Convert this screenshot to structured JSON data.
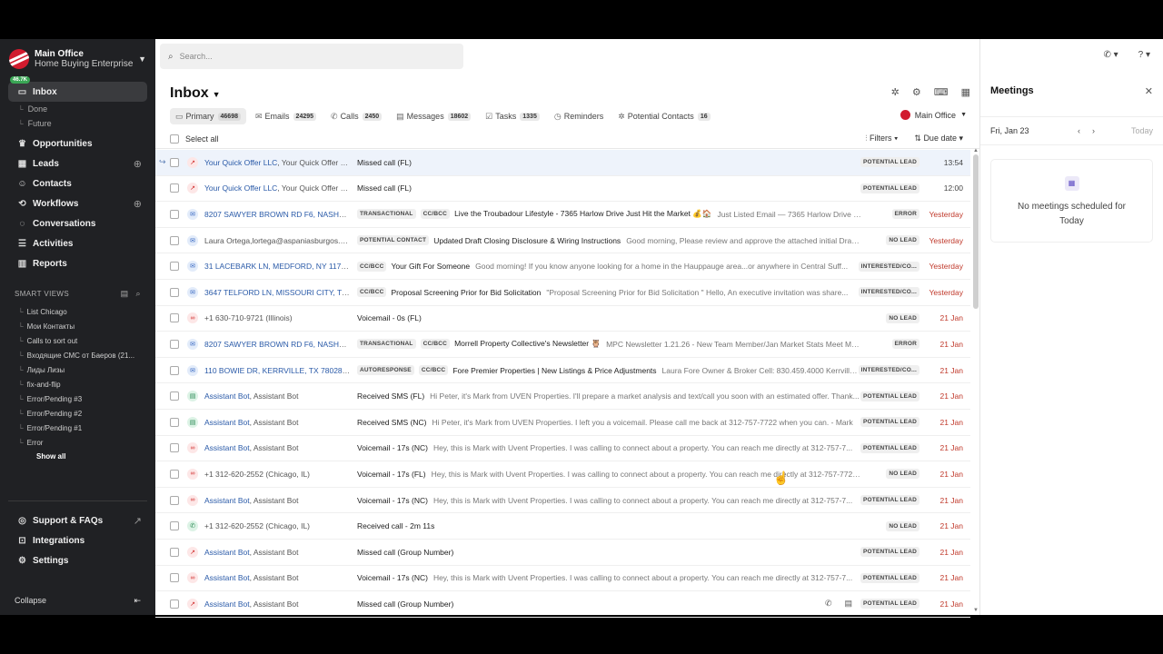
{
  "org": {
    "name": "Main Office",
    "subtitle": "Home Buying Enterprise"
  },
  "nav": {
    "inbox_badge": "46.7K",
    "inbox": "Inbox",
    "done": "Done",
    "future": "Future",
    "opportunities": "Opportunities",
    "leads": "Leads",
    "contacts": "Contacts",
    "workflows": "Workflows",
    "conversations": "Conversations",
    "activities": "Activities",
    "reports": "Reports",
    "support": "Support & FAQs",
    "integrations": "Integrations",
    "settings": "Settings",
    "collapse": "Collapse"
  },
  "smart_views": {
    "header": "SMART VIEWS",
    "items": [
      "List Chicago",
      "Мои Контакты",
      "Calls to sort out",
      "Входящие СМС от Баеров (21...",
      "Лиды Лизы",
      "fix-and-flip",
      "Error/Pending #3",
      "Error/Pending #2",
      "Error/Pending #1",
      "Error"
    ],
    "show_all": "Show all"
  },
  "search": {
    "placeholder": "Search..."
  },
  "inbox": {
    "title": "Inbox",
    "tabs": [
      {
        "label": "Primary",
        "count": "46698"
      },
      {
        "label": "Emails",
        "count": "24295"
      },
      {
        "label": "Calls",
        "count": "2450"
      },
      {
        "label": "Messages",
        "count": "18602"
      },
      {
        "label": "Tasks",
        "count": "1335"
      },
      {
        "label": "Reminders",
        "count": ""
      },
      {
        "label": "Potential Contacts",
        "count": "16"
      }
    ],
    "office": "Main Office",
    "select_all": "Select all",
    "filters": "Filters",
    "sort": "Due date"
  },
  "rows": [
    {
      "type": "missed",
      "name": "Your Quick Offer LLC",
      "extra": ", Your Quick Offer LLC",
      "tags": [],
      "subject": "Missed call (FL)",
      "preview": "",
      "status": "POTENTIAL LEAD",
      "date": "13:54",
      "now": true,
      "hl": true
    },
    {
      "type": "missed",
      "name": "Your Quick Offer LLC",
      "extra": ", Your Quick Offer LLC",
      "tags": [],
      "subject": "Missed call (FL)",
      "preview": "",
      "status": "POTENTIAL LEAD",
      "date": "12:00",
      "now": true
    },
    {
      "type": "email",
      "name": "8207 SAWYER BROWN RD F6, NASHVILL...",
      "extra": "",
      "tags": [
        "TRANSACTIONAL",
        "CC/BCC"
      ],
      "subject": "Live the Troubadour Lifestyle - 7365 Harlow Drive Just Hit the Market 💰🏠",
      "preview": "Just Listed Email — 7365 Harlow Drive Live the ...",
      "status": "ERROR",
      "date": "Yesterday"
    },
    {
      "type": "email",
      "name": "",
      "extra": "Laura Ortega,lortega@aspaniasburgos.com",
      "tags": [
        "POTENTIAL CONTACT"
      ],
      "subject": "Updated Draft Closing Disclosure & Wiring Instructions",
      "preview": "Good morning, Please review and approve the attached initial Draft C...",
      "status": "NO LEAD",
      "date": "Yesterday"
    },
    {
      "type": "email",
      "name": "31 LACEBARK LN, MEDFORD, NY 11763 ...",
      "extra": "",
      "tags": [
        "CC/BCC"
      ],
      "subject": "Your Gift For Someone",
      "preview": "Good morning! If you know anyone looking for a home in the Hauppauge area...or anywhere in Central Suff...",
      "status": "INTERESTED/CO...",
      "date": "Yesterday"
    },
    {
      "type": "email",
      "name": "3647 TELFORD LN, MISSOURI CITY, TX 7...",
      "extra": "",
      "tags": [
        "CC/BCC"
      ],
      "subject": "Proposal Screening Prior for Bid Solicitation",
      "preview": "\"Proposal Screening Prior for Bid Solicitation \" Hello, An executive invitation was share...",
      "status": "INTERESTED/CO...",
      "date": "Yesterday"
    },
    {
      "type": "vm",
      "name": "",
      "extra": "+1 630-710-9721 (Illinois)",
      "tags": [],
      "subject": "Voicemail - 0s (FL)",
      "preview": "",
      "status": "NO LEAD",
      "date": "21 Jan"
    },
    {
      "type": "email",
      "name": "8207 SAWYER BROWN RD F6, NASHVILL...",
      "extra": "",
      "tags": [
        "TRANSACTIONAL",
        "CC/BCC"
      ],
      "subject": "Morrell Property Collective's Newsletter 🦉",
      "preview": "MPC Newsletter 1.21.26 - New Team Member/Jan Market Stats Meet MPC's Ne...",
      "status": "ERROR",
      "date": "21 Jan"
    },
    {
      "type": "email",
      "name": "110 BOWIE DR, KERRVILLE, TX 78028 & ...",
      "extra": "",
      "tags": [
        "AUTORESPONSE",
        "CC/BCC"
      ],
      "subject": "Fore Premier Properties | New Listings & Price Adjustments",
      "preview": "Laura Fore Owner & Broker Cell: 830.459.4000 Kerrville:...",
      "status": "INTERESTED/CO...",
      "date": "21 Jan"
    },
    {
      "type": "sms",
      "name": "Assistant Bot",
      "extra": ", Assistant Bot",
      "tags": [],
      "subject": "Received SMS (FL)",
      "preview": "Hi Peter, it's Mark from UVEN Properties. I'll prepare a market analysis and text/call you soon with an estimated offer. Thank...",
      "status": "POTENTIAL LEAD",
      "date": "21 Jan"
    },
    {
      "type": "sms",
      "name": "Assistant Bot",
      "extra": ", Assistant Bot",
      "tags": [],
      "subject": "Received SMS (NC)",
      "preview": "Hi Peter, it's Mark from UVEN Properties. I left you a voicemail. Please call me back at 312-757-7722 when you can. - Mark",
      "status": "POTENTIAL LEAD",
      "date": "21 Jan"
    },
    {
      "type": "vm",
      "name": "Assistant Bot",
      "extra": ", Assistant Bot",
      "tags": [],
      "subject": "Voicemail - 17s (NC)",
      "preview": "Hey, this is Mark with Uvent Properties. I was calling to connect about a property. You can reach me directly at 312-757-7...",
      "status": "POTENTIAL LEAD",
      "date": "21 Jan"
    },
    {
      "type": "vm",
      "name": "",
      "extra": "+1 312-620-2552 (Chicago, IL)",
      "tags": [],
      "subject": "Voicemail - 17s (FL)",
      "preview": "Hey, this is Mark with Uvent Properties. I was calling to connect about a property. You can reach me directly at 312-757-7722. Ag...",
      "status": "NO LEAD",
      "date": "21 Jan"
    },
    {
      "type": "vm",
      "name": "Assistant Bot",
      "extra": ", Assistant Bot",
      "tags": [],
      "subject": "Voicemail - 17s (NC)",
      "preview": "Hey, this is Mark with Uvent Properties. I was calling to connect about a property. You can reach me directly at 312-757-7...",
      "status": "POTENTIAL LEAD",
      "date": "21 Jan"
    },
    {
      "type": "call",
      "name": "",
      "extra": "+1 312-620-2552 (Chicago, IL)",
      "tags": [],
      "subject": "Received call - 2m 11s",
      "preview": "",
      "status": "NO LEAD",
      "date": "21 Jan"
    },
    {
      "type": "missed",
      "name": "Assistant Bot",
      "extra": ", Assistant Bot",
      "tags": [],
      "subject": "Missed call (Group Number)",
      "preview": "",
      "status": "POTENTIAL LEAD",
      "date": "21 Jan"
    },
    {
      "type": "vm",
      "name": "Assistant Bot",
      "extra": ", Assistant Bot",
      "tags": [],
      "subject": "Voicemail - 17s (NC)",
      "preview": "Hey, this is Mark with Uvent Properties. I was calling to connect about a property. You can reach me directly at 312-757-7...",
      "status": "POTENTIAL LEAD",
      "date": "21 Jan"
    },
    {
      "type": "missed",
      "name": "Assistant Bot",
      "extra": ", Assistant Bot",
      "tags": [],
      "subject": "Missed call (Group Number)",
      "preview": "",
      "status": "POTENTIAL LEAD",
      "date": "21 Jan",
      "actions": true
    }
  ],
  "meetings": {
    "title": "Meetings",
    "date": "Fri, Jan 23",
    "today": "Today",
    "empty_line1": "No meetings scheduled for",
    "empty_line2": "Today"
  },
  "icons": {
    "missed": "↗",
    "email": "✉",
    "vm": "∞",
    "sms": "▤",
    "call": "✆"
  },
  "colors": {
    "accent": "#2a5aa8",
    "sidebar": "#202124",
    "date_red": "#c0392b",
    "brand": "#d11b2e",
    "badge": "#3aa655"
  }
}
